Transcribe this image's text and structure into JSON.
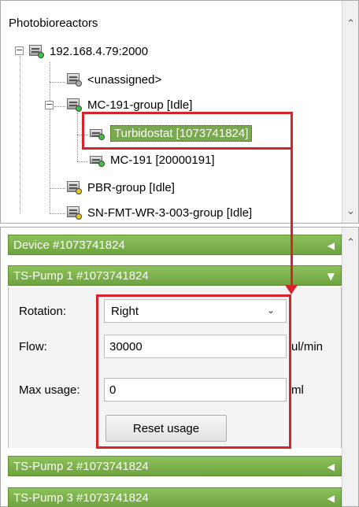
{
  "tree": {
    "root": "Photobioreactors",
    "host": "192.168.4.79:2000",
    "nodes": [
      "<unassigned>",
      "MC-191-group [Idle]",
      "Turbidostat [1073741824]",
      "MC-191 [20000191]",
      "PBR-group [Idle]",
      "SN-FMT-WR-3-003-group [Idle]"
    ]
  },
  "panels": {
    "device": "Device #1073741824",
    "pump1": "TS-Pump 1 #1073741824",
    "pump2": "TS-Pump 2 #1073741824",
    "pump3": "TS-Pump 3 #1073741824"
  },
  "form": {
    "rotation_label": "Rotation:",
    "rotation_value": "Right",
    "flow_label": "Flow:",
    "flow_value": "30000",
    "flow_unit": "ul/min",
    "max_usage_label": "Max usage:",
    "max_usage_value": "0",
    "max_usage_unit": "ml",
    "reset_label": "Reset usage"
  },
  "colors": {
    "accent": "#7aa84e",
    "annotation": "#d6242a"
  }
}
